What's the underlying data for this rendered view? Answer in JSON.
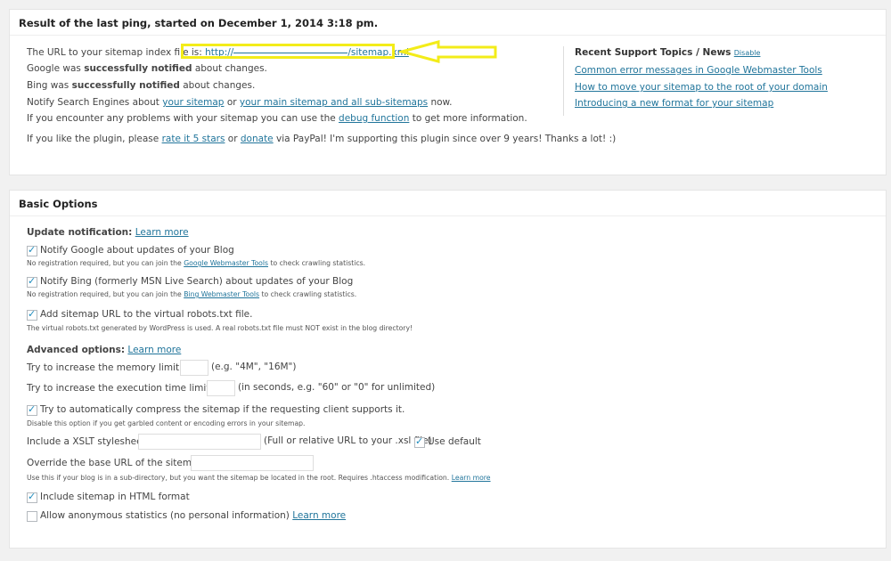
{
  "ping_box": {
    "title": "Result of the last ping, started on December 1, 2014 3:18 pm.",
    "url_intro": "The URL to your sitemap index file is:",
    "url_prefix": "http://",
    "url_suffix": "/sitemap.xml",
    "url_end": ".",
    "google_pre": "Google was",
    "google_bold": "successfully notified",
    "google_post": "about changes.",
    "bing_pre": "Bing was",
    "bing_bold": "successfully notified",
    "bing_post": "about changes.",
    "notify_pre": "Notify Search Engines about",
    "notify_link1": "your sitemap",
    "notify_or": "or",
    "notify_link2": "your main sitemap and all sub-sitemaps",
    "notify_post": "now.",
    "problems_pre": "If you encounter any problems with your sitemap you can use the",
    "problems_link": "debug function",
    "problems_post": "to get more information.",
    "like_pre": "If you like the plugin, please",
    "like_link1": "rate it 5 stars",
    "like_or": "or",
    "like_link2": "donate",
    "like_post": "via PayPal! I'm supporting this plugin since over 9 years! Thanks a lot! :)"
  },
  "support": {
    "title": "Recent Support Topics / News",
    "disable": "Disable",
    "links": [
      "Common error messages in Google Webmaster Tools",
      "How to move your sitemap to the root of your domain",
      "Introducing a new format for your sitemap"
    ]
  },
  "basic": {
    "title": "Basic Options",
    "update_label": "Update notification:",
    "learn_more": "Learn more",
    "notify_google": "Notify Google about updates of your Blog",
    "google_note_pre": "No registration required, but you can join the",
    "google_note_link": "Google Webmaster Tools",
    "google_note_post": "to check crawling statistics.",
    "notify_bing": "Notify Bing (formerly MSN Live Search) about updates of your Blog",
    "bing_note_pre": "No registration required, but you can join the",
    "bing_note_link": "Bing Webmaster Tools",
    "bing_note_post": "to check crawling statistics.",
    "robots": "Add sitemap URL to the virtual robots.txt file.",
    "robots_note": "The virtual robots.txt generated by WordPress is used. A real robots.txt file must NOT exist in the blog directory!",
    "advanced_label": "Advanced options:",
    "memory_label": "Try to increase the memory limit to:",
    "memory_hint": "(e.g. \"4M\", \"16M\")",
    "time_label": "Try to increase the execution time limit to:",
    "time_hint": "(in seconds, e.g. \"60\" or \"0\" for unlimited)",
    "compress": "Try to automatically compress the sitemap if the requesting client supports it.",
    "compress_note": "Disable this option if you get garbled content or encoding errors in your sitemap.",
    "xslt_label": "Include a XSLT stylesheet:",
    "xslt_hint": "(Full or relative URL to your .xsl file)",
    "use_default": "Use default",
    "base_url_label": "Override the base URL of the sitemap:",
    "base_url_note": "Use this if your blog is in a sub-directory, but you want the sitemap be located in the root. Requires .htaccess modification.",
    "html_format": "Include sitemap in HTML format",
    "anon_stats": "Allow anonymous statistics (no personal information)"
  },
  "checkboxes": {
    "notify_google": true,
    "notify_bing": true,
    "robots": true,
    "compress": true,
    "use_default": true,
    "html_format": true,
    "anon_stats": false
  },
  "colors": {
    "link": "#21759b",
    "highlight": "#f3ec19",
    "check": "#1e8cbe"
  }
}
